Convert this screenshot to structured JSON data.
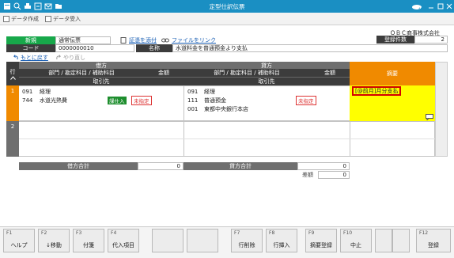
{
  "window": {
    "title": "定型仕訳伝票",
    "company": "ＯＢＣ商事株式会社"
  },
  "toolbar": {
    "create": "データ作成",
    "receive": "データ受入"
  },
  "header": {
    "new_badge": "新規",
    "slip_type": "通常伝票",
    "attach_label": "証憑を添付",
    "link_label": "ファイルをリンク",
    "count_label": "登録件数",
    "count_value": "2",
    "code_label": "コード",
    "code_value": "0000000010",
    "name_label": "名称",
    "name_value": "水道料金を普通預金より支払"
  },
  "nav": {
    "undo": "もとに戻す",
    "redo": "やり直し"
  },
  "grid": {
    "row_header": "行",
    "debit_title": "借方",
    "credit_title": "貸方",
    "account_col": "部門 / 勘定科目 / 補助科目",
    "amount_col": "金額",
    "partner_col": "取引先",
    "summary_col": "摘要"
  },
  "rows": [
    {
      "no": "1",
      "debit": {
        "dept": "091",
        "dept_name": "経理",
        "acct": "744",
        "acct_name": "水道光熱費",
        "tax": "課仕入",
        "amount": "未指定"
      },
      "credit": {
        "dept": "091",
        "dept_name": "経理",
        "acct": "111",
        "acct_name": "普通預金",
        "sub": "001",
        "sub_name": "東都中央銀行本店",
        "amount": "未指定"
      },
      "summary": "[@前月]月分支払"
    },
    {
      "no": "2"
    }
  ],
  "totals": {
    "debit_label": "借方合計",
    "debit_value": "0",
    "credit_label": "貸方合計",
    "credit_value": "0",
    "diff_label": "差額",
    "diff_value": "0"
  },
  "fkeys": [
    {
      "key": "F1",
      "label": "ヘルプ"
    },
    {
      "key": "F2",
      "label": "↓移動"
    },
    {
      "key": "F3",
      "label": "付箋"
    },
    {
      "key": "F4",
      "label": "代入項目"
    },
    {
      "key": "",
      "label": ""
    },
    {
      "key": "",
      "label": ""
    },
    {
      "key": "F7",
      "label": "行削除"
    },
    {
      "key": "F8",
      "label": "行挿入"
    },
    {
      "key": "F9",
      "label": "摘要登録"
    },
    {
      "key": "F10",
      "label": "中止"
    },
    {
      "key": "",
      "label": ""
    },
    {
      "key": "",
      "label": ""
    },
    {
      "key": "F12",
      "label": "登録"
    }
  ],
  "colors": {
    "title_bar": "#1a8fc3",
    "summary_header": "#f08a00",
    "summary_cell": "#ffff00",
    "row_marker": "#f08a00",
    "new_badge": "#17a84a"
  }
}
